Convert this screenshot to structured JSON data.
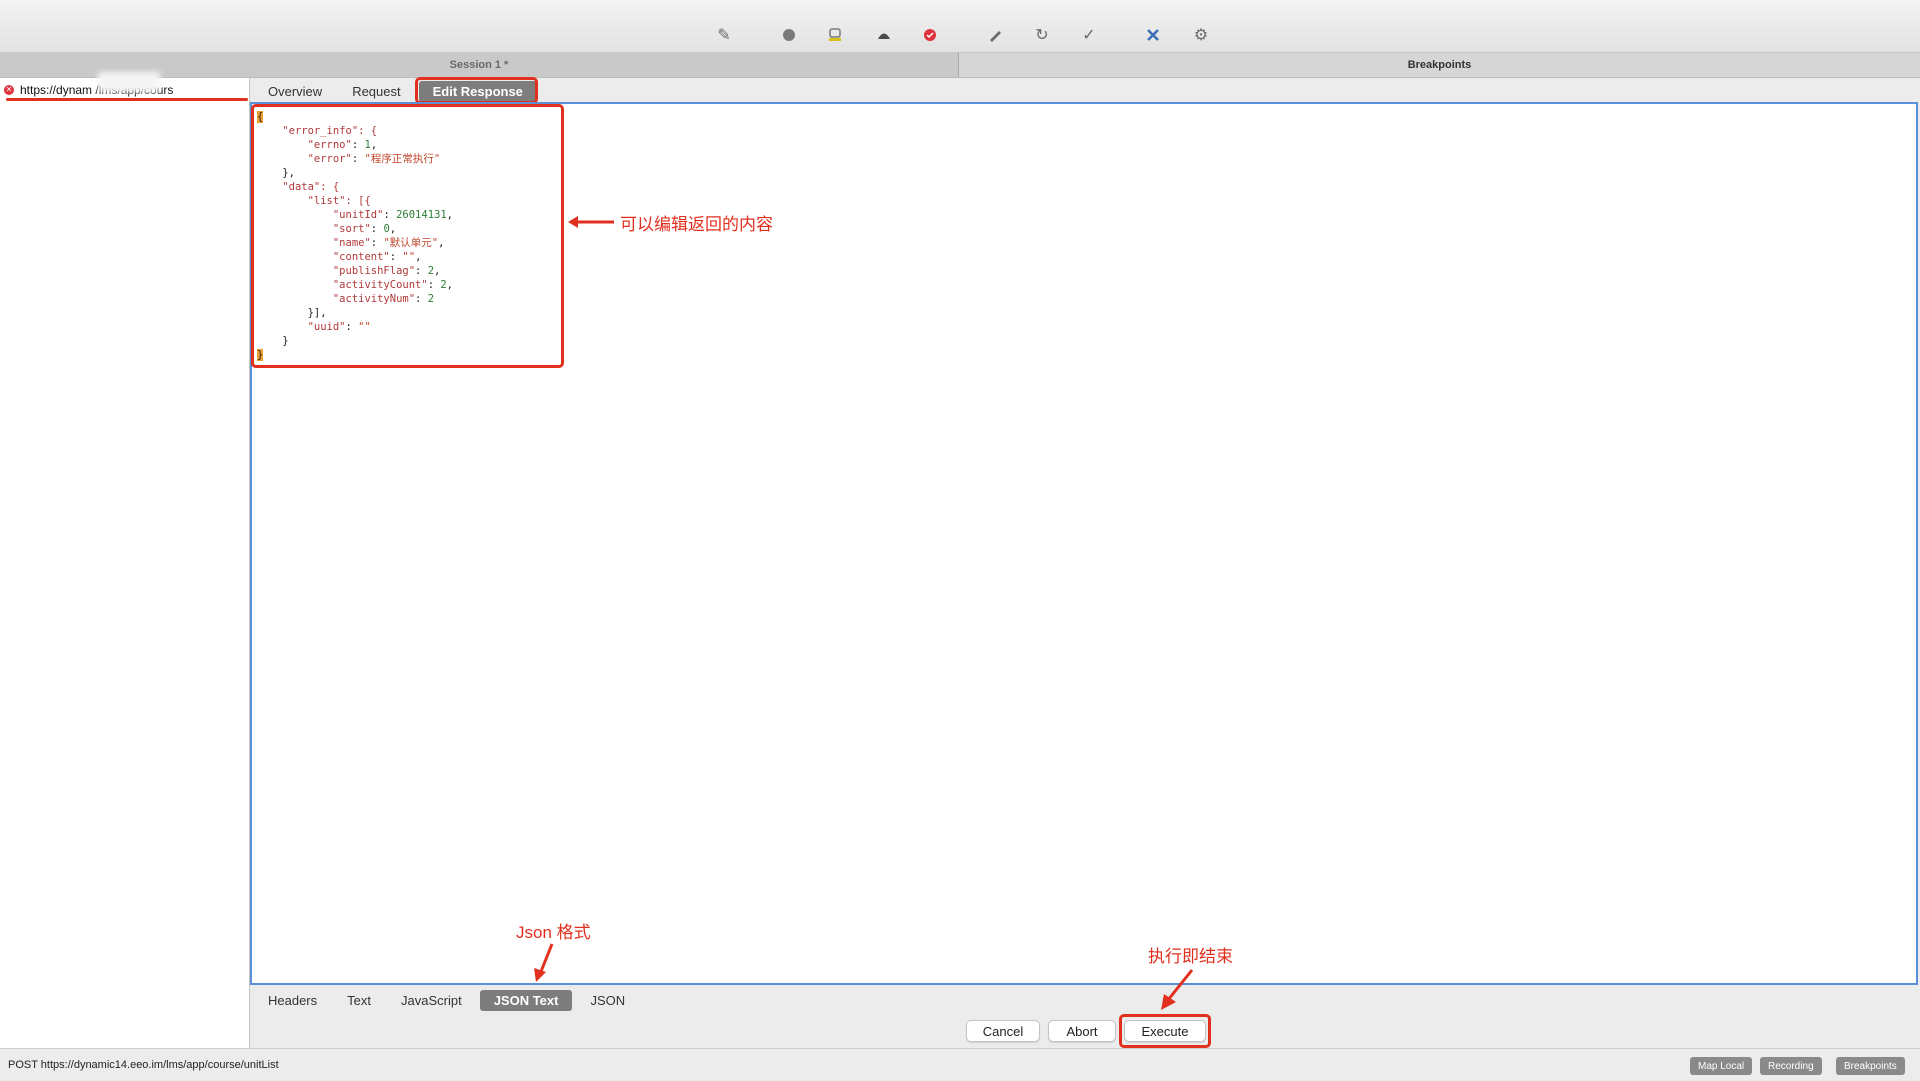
{
  "session_tab": "Session 1 *",
  "breakpoints_tab": "Breakpoints",
  "toolbar": {
    "icons": [
      "broom-icon",
      "record-icon",
      "throttle-icon",
      "turtle-icon",
      "breakpoint-icon",
      "pen-icon",
      "refresh-icon",
      "check-icon",
      "tools-icon",
      "settings-icon"
    ]
  },
  "left": {
    "url": "https://dynam              /lms/app/cours"
  },
  "top_tabs": {
    "overview": "Overview",
    "request": "Request",
    "edit_response": "Edit Response"
  },
  "json_lines": {
    "l1": "{",
    "l2": "\"error_info\": {",
    "l3a": "\"errno\"",
    "l3b": "1",
    "l4a": "\"error\"",
    "l4b": "\"程序正常执行\"",
    "l5": "},",
    "l6": "\"data\": {",
    "l7": "\"list\": [{",
    "l8a": "\"unitId\"",
    "l8b": "26014131",
    "l9a": "\"sort\"",
    "l9b": "0",
    "l10a": "\"name\"",
    "l10b": "\"默认单元\"",
    "l11a": "\"content\"",
    "l11b": "\"\"",
    "l12a": "\"publishFlag\"",
    "l12b": "2",
    "l13a": "\"activityCount\"",
    "l13b": "2",
    "l14a": "\"activityNum\"",
    "l14b": "2",
    "l15": "}],",
    "l16a": "\"uuid\"",
    "l16b": "\"\"",
    "l17": "}",
    "l18": "}"
  },
  "annotations": {
    "edit_note": "可以编辑返回的内容",
    "json_format": "Json 格式",
    "execute_note": "执行即结束"
  },
  "bottom_tabs": {
    "headers": "Headers",
    "text": "Text",
    "javascript": "JavaScript",
    "json_text": "JSON Text",
    "json": "JSON"
  },
  "buttons": {
    "cancel": "Cancel",
    "abort": "Abort",
    "execute": "Execute"
  },
  "status": {
    "text": "POST https://dynamic14.eeo.im/lms/app/course/unitList",
    "map_local": "Map Local",
    "recording": "Recording",
    "breakpoints": "Breakpoints"
  },
  "colors": {
    "annotation_red": "#e2301f",
    "editor_border": "#5b8fd6",
    "active_tab": "#7d7d7d"
  }
}
